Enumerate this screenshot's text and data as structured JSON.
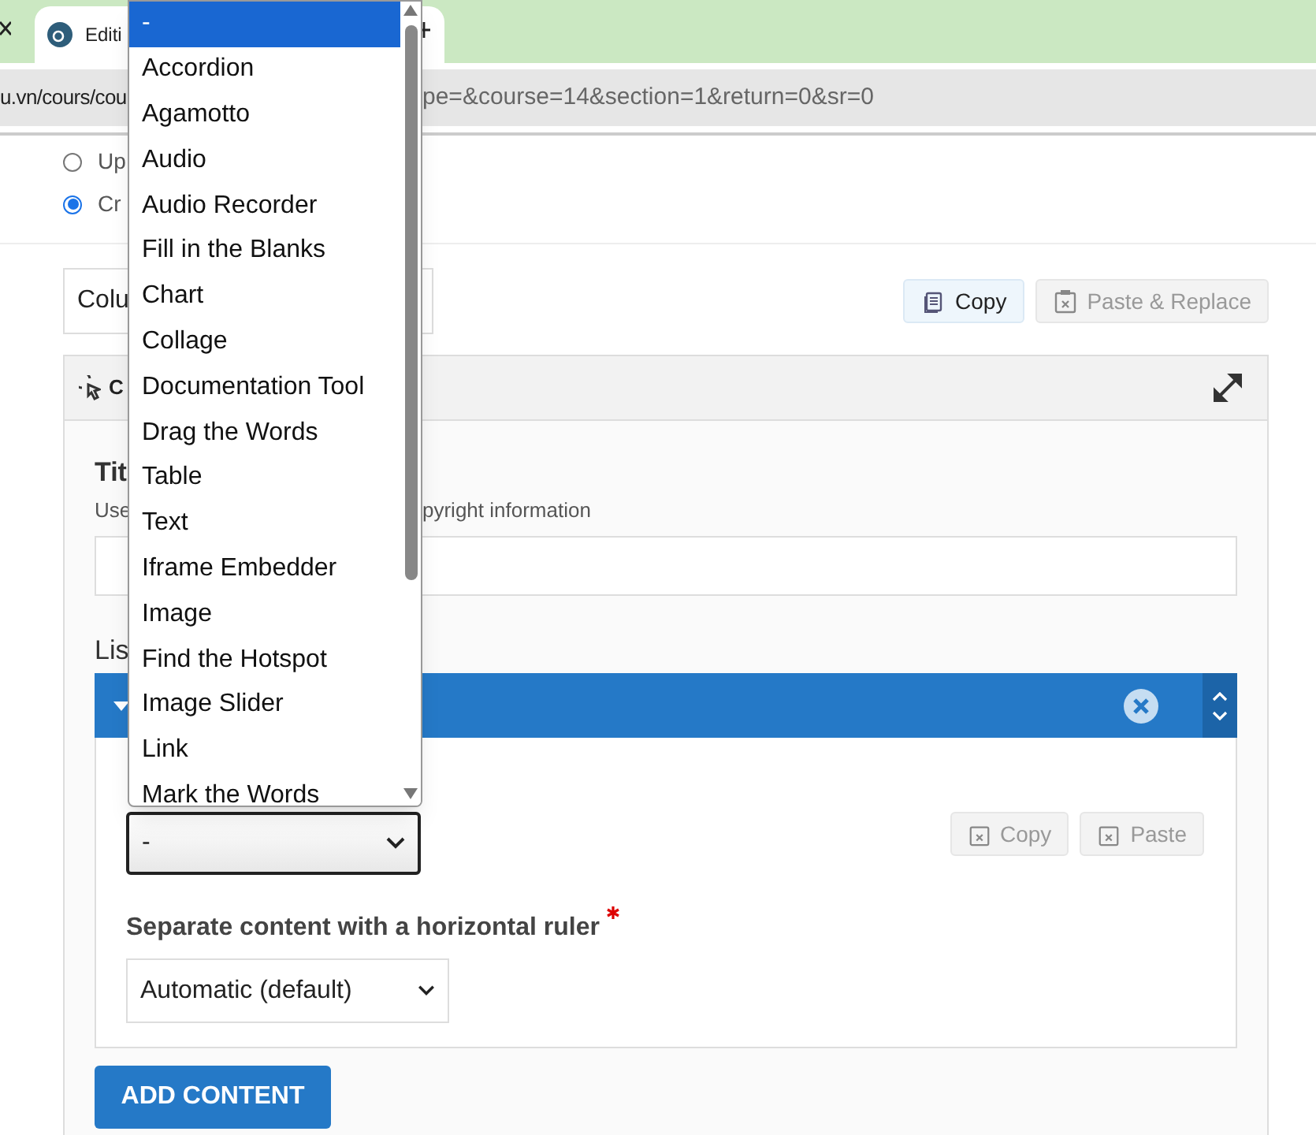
{
  "browser": {
    "tab": {
      "title": "Editi"
    },
    "address": {
      "left": "u.vn/cours/cou",
      "right": "pe=&course=14&section=1&return=0&sr=0"
    }
  },
  "radios": [
    {
      "label": "Up",
      "selected": false
    },
    {
      "label": "Cr",
      "selected": true
    }
  ],
  "layout_select": {
    "value": "Colu"
  },
  "top_buttons": [
    {
      "label": "Copy",
      "disabled": false
    },
    {
      "label": "Paste & Replace",
      "disabled": true
    }
  ],
  "panel": {
    "title": "C",
    "title_field": {
      "label": "Tit",
      "help_left": "Use",
      "help_right": "pyright information"
    },
    "list_label": "Lis",
    "item": {
      "expanded": true,
      "content_select": {
        "value": "-"
      },
      "buttons": [
        {
          "label": "Copy",
          "disabled": true
        },
        {
          "label": "Paste",
          "disabled": true
        }
      ],
      "ruler_label": "Separate content with a horizontal ruler",
      "required": true,
      "ruler_select": {
        "value": "Automatic (default)"
      }
    },
    "add_button": "ADD CONTENT"
  },
  "dropdown": {
    "options": [
      {
        "label": "-",
        "selected": true
      },
      {
        "label": "Accordion",
        "selected": false
      },
      {
        "label": "Agamotto",
        "selected": false
      },
      {
        "label": "Audio",
        "selected": false
      },
      {
        "label": "Audio Recorder",
        "selected": false
      },
      {
        "label": "Fill in the Blanks",
        "selected": false
      },
      {
        "label": "Chart",
        "selected": false
      },
      {
        "label": "Collage",
        "selected": false
      },
      {
        "label": "Documentation Tool",
        "selected": false
      },
      {
        "label": "Drag the Words",
        "selected": false
      },
      {
        "label": "Table",
        "selected": false
      },
      {
        "label": "Text",
        "selected": false
      },
      {
        "label": "Iframe Embedder",
        "selected": false
      },
      {
        "label": "Image",
        "selected": false
      },
      {
        "label": "Find the Hotspot",
        "selected": false
      },
      {
        "label": "Image Slider",
        "selected": false
      },
      {
        "label": "Link",
        "selected": false
      },
      {
        "label": "Mark the Words",
        "selected": false
      }
    ]
  }
}
